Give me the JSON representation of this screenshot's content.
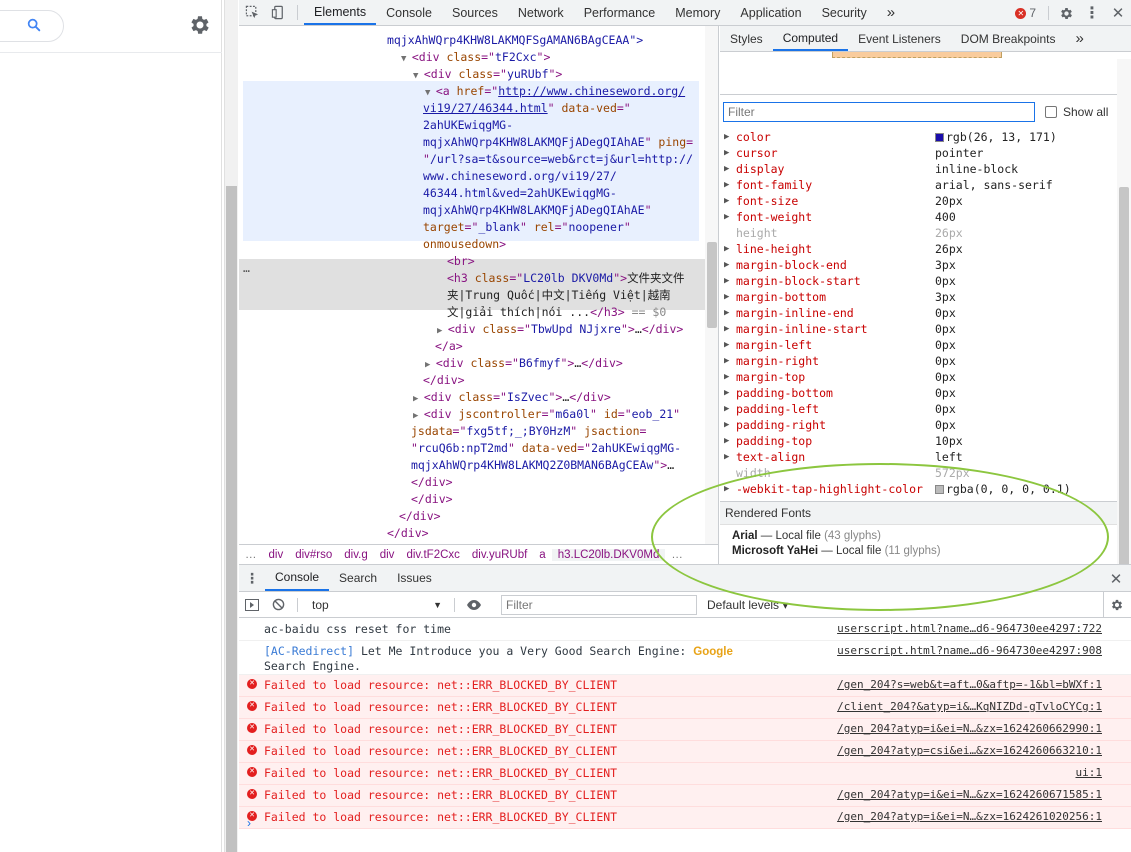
{
  "devtools": {
    "tabs": [
      "Elements",
      "Console",
      "Sources",
      "Network",
      "Performance",
      "Memory",
      "Application",
      "Security"
    ],
    "more_tabs": "»",
    "error_count": "7"
  },
  "dom": [
    {
      "html_key": "l0"
    },
    {
      "html_key": "l1"
    }
  ],
  "dom_text": {
    "l0": "mqjxAhWQrp4KHW8LAKMQFSgAMAN6BAgCEAA\">",
    "l1_tag": "div",
    "l1_val": "tF2Cxc",
    "l2_val": "yuRUbf",
    "a_href": "http://www.chineseword.org/",
    "a_href2": "vi19/27/46344.html",
    "a_ved_attr": "data-ved",
    "a_ved1": "2ahUKEwiqgMG-",
    "a_ved2": "mqjxAhWQrp4KHW8LAKMQFjADegQIAhAE",
    "a_ping": "ping",
    "a_ping1": "/url?sa=t&source=web&rct=j&url=http://",
    "a_ping2": "www.chineseword.org/vi19/27/",
    "a_ping3": "46344.html&ved=2ahUKEwiqgMG-",
    "a_ping4": "mqjxAhWQrp4KHW8LAKMQFjADegQIAhAE",
    "a_target": "_blank",
    "a_rel": "noopener",
    "a_onmouse": "onmousedown",
    "br": "<br>",
    "h3_class": "LC20lb DKV0Md",
    "h3_text1": "文件夹文件",
    "h3_text2": "夹|Trung Quốc|中文|Tiếng Việt|越南",
    "h3_text3": "文|giải thích|nói ...",
    "h3_eq": "== $0",
    "div_tbw": "TbwUpd NJjxre",
    "div_b6": "B6fmyf",
    "div_is": "IsZvec",
    "ctl_val": "m6a0l",
    "id_val": "eob_21",
    "jsdata_val": "fxg5tf;_;BY0HzM",
    "jsaction_val": "rcuQ6b:npT2md",
    "ved_last1": "2ahUKEwiqgMG-",
    "ved_last2": "mqjxAhWQrp4KHW8LAKMQ2Z0BMAN6BAgCEAw",
    "div_g": "g",
    "ellipsis": "…",
    "dots": "…"
  },
  "breadcrumb": [
    "…",
    "div",
    "div#rso",
    "div.g",
    "div",
    "div.tF2Cxc",
    "div.yuRUbf",
    "a",
    "h3.LC20lb.DKV0Md",
    "…"
  ],
  "side": {
    "tabs": [
      "Styles",
      "Computed",
      "Event Listeners",
      "DOM Breakpoints"
    ],
    "more": "»",
    "filter_placeholder": "Filter",
    "show_all": "Show all",
    "props": [
      {
        "name": "color",
        "value": "rgb(26, 13, 171)",
        "swatch": "#1a0dab"
      },
      {
        "name": "cursor",
        "value": "pointer"
      },
      {
        "name": "display",
        "value": "inline-block"
      },
      {
        "name": "font-family",
        "value": "arial, sans-serif"
      },
      {
        "name": "font-size",
        "value": "20px"
      },
      {
        "name": "font-weight",
        "value": "400"
      },
      {
        "name": "height",
        "value": "26px",
        "dim": true
      },
      {
        "name": "line-height",
        "value": "26px"
      },
      {
        "name": "margin-block-end",
        "value": "3px"
      },
      {
        "name": "margin-block-start",
        "value": "0px"
      },
      {
        "name": "margin-bottom",
        "value": "3px"
      },
      {
        "name": "margin-inline-end",
        "value": "0px"
      },
      {
        "name": "margin-inline-start",
        "value": "0px"
      },
      {
        "name": "margin-left",
        "value": "0px"
      },
      {
        "name": "margin-right",
        "value": "0px"
      },
      {
        "name": "margin-top",
        "value": "0px"
      },
      {
        "name": "padding-bottom",
        "value": "0px"
      },
      {
        "name": "padding-left",
        "value": "0px"
      },
      {
        "name": "padding-right",
        "value": "0px"
      },
      {
        "name": "padding-top",
        "value": "10px"
      },
      {
        "name": "text-align",
        "value": "left"
      },
      {
        "name": "width",
        "value": "572px",
        "dim": true
      },
      {
        "name": "-webkit-tap-highlight-color",
        "value": "rgba(0, 0, 0, 0.1)",
        "swatch": "#bbbbbb"
      }
    ],
    "rendered_fonts_title": "Rendered Fonts",
    "fonts": [
      {
        "name": "Arial",
        "source": "Local file",
        "glyphs": "(43 glyphs)"
      },
      {
        "name": "Microsoft YaHei",
        "source": "Local file",
        "glyphs": "(11 glyphs)"
      }
    ],
    "dash": "—"
  },
  "drawer": {
    "tabs": [
      "Console",
      "Search",
      "Issues"
    ],
    "context": "top",
    "filter_placeholder": "Filter",
    "levels": "Default levels ▾"
  },
  "console": {
    "logs": [
      {
        "msg": "ac-baidu css reset for time",
        "src": "userscript.html?name…d6-964730ee4297:722"
      },
      {
        "tag": "[AC-Redirect]",
        "msg": " Let Me Introduce you a Very Good Search Engine: ",
        "google": "Google",
        "msg2": "Search Engine.",
        "src": "userscript.html?name…d6-964730ee4297:908"
      }
    ],
    "errors": [
      {
        "msg": "Failed to load resource: net::ERR_BLOCKED_BY_CLIENT",
        "src": "/gen_204?s=web&t=aft…0&aftp=-1&bl=bWXf:1"
      },
      {
        "msg": "Failed to load resource: net::ERR_BLOCKED_BY_CLIENT",
        "src": "/client_204?&atyp=i&…KqNIZDd-gTvloCYCg:1"
      },
      {
        "msg": "Failed to load resource: net::ERR_BLOCKED_BY_CLIENT",
        "src": "/gen_204?atyp=i&ei=N…&zx=1624260662990:1"
      },
      {
        "msg": "Failed to load resource: net::ERR_BLOCKED_BY_CLIENT",
        "src": "/gen_204?atyp=csi&ei…&zx=1624260663210:1"
      },
      {
        "msg": "Failed to load resource: net::ERR_BLOCKED_BY_CLIENT",
        "src": "ui:1"
      },
      {
        "msg": "Failed to load resource: net::ERR_BLOCKED_BY_CLIENT",
        "src": "/gen_204?atyp=i&ei=N…&zx=1624260671585:1"
      },
      {
        "msg": "Failed to load resource: net::ERR_BLOCKED_BY_CLIENT",
        "src": "/gen_204?atyp=i&ei=N…&zx=1624261020256:1"
      }
    ],
    "prompt": "›"
  }
}
